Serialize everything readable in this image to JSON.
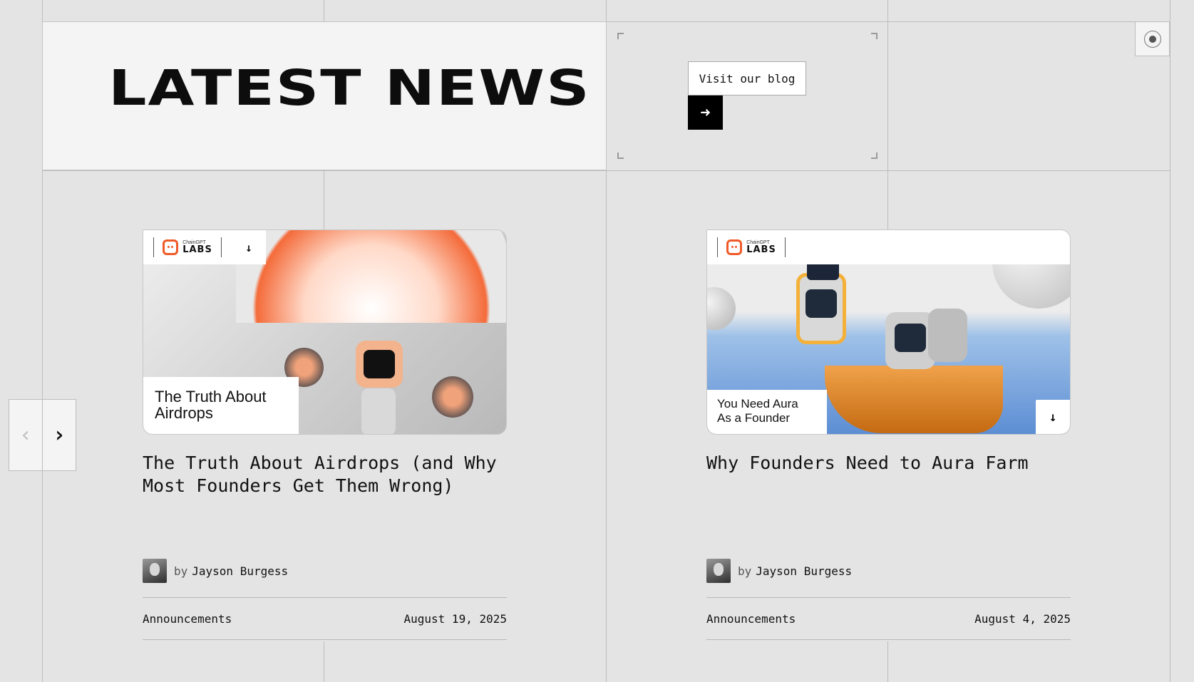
{
  "header": {
    "title": "LATEST NEWS",
    "blog_label": "Visit our blog",
    "blog_arrow_icon": "arrow-right-icon"
  },
  "carousel": {
    "prev_icon": "chevron-left-icon",
    "next_icon": "chevron-right-icon",
    "toggle_icon": "radio-dot-icon"
  },
  "brand": {
    "small": "ChainGPT",
    "big": "LABS"
  },
  "posts": [
    {
      "image_caption_line1": "The Truth About",
      "image_caption_line2": "Airdrops",
      "title": "The Truth About Airdrops (and Why Most Founders Get Them Wrong)",
      "by": "by",
      "author": "Jayson Burgess",
      "category": "Announcements",
      "date": "August 19, 2025"
    },
    {
      "image_caption_line1": "You Need Aura",
      "image_caption_line2": "As a Founder",
      "title": "Why Founders Need to Aura Farm",
      "by": "by",
      "author": "Jayson Burgess",
      "category": "Announcements",
      "date": "August 4, 2025"
    }
  ],
  "colors": {
    "accent": "#f05a28",
    "background": "#e4e4e4",
    "panel": "#f4f4f4"
  }
}
